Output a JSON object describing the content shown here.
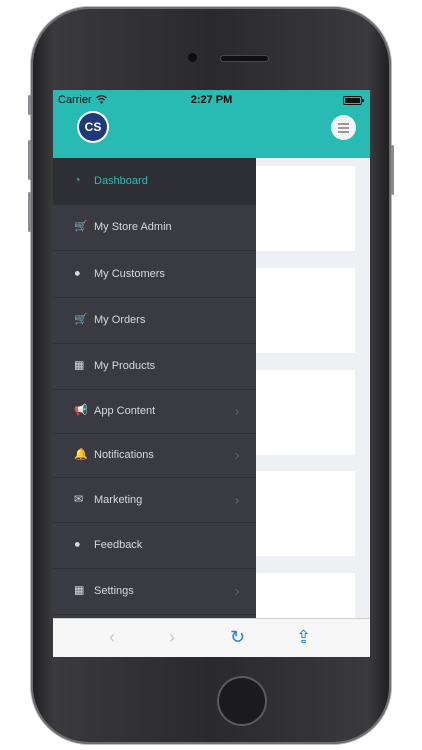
{
  "status_bar": {
    "carrier": "Carrier",
    "time": "2:27 PM"
  },
  "header": {
    "logo_text": "CS",
    "menu_icon": "hamburger-icon"
  },
  "drawer": {
    "items": [
      {
        "label": "Dashboard",
        "icon": "dashboard-icon",
        "glyph": "◔",
        "active": true,
        "submenu": false
      },
      {
        "label": "My Store Admin",
        "icon": "cart-icon",
        "glyph": "🛒",
        "active": false,
        "submenu": false
      },
      {
        "label": "My Customers",
        "icon": "user-icon",
        "glyph": "●",
        "active": false,
        "submenu": false
      },
      {
        "label": "My Orders",
        "icon": "cart-icon",
        "glyph": "🛒",
        "active": false,
        "submenu": false
      },
      {
        "label": "My Products",
        "icon": "grid-icon",
        "glyph": "▦",
        "active": false,
        "submenu": false
      },
      {
        "label": "App Content",
        "icon": "bullhorn-icon",
        "glyph": "📢",
        "active": false,
        "submenu": true
      },
      {
        "label": "Notifications",
        "icon": "bell-icon",
        "glyph": "🔔",
        "active": false,
        "submenu": true
      },
      {
        "label": "Marketing",
        "icon": "envelope-icon",
        "glyph": "✉",
        "active": false,
        "submenu": true
      },
      {
        "label": "Feedback",
        "icon": "user-icon",
        "glyph": "●",
        "active": false,
        "submenu": false
      },
      {
        "label": "Settings",
        "icon": "grid-icon",
        "glyph": "▦",
        "active": false,
        "submenu": true
      }
    ],
    "chevron": "›"
  },
  "toolbar": {
    "back": {
      "icon": "back-arrow-icon",
      "glyph": "‹",
      "enabled": false
    },
    "forward": {
      "icon": "forward-arrow-icon",
      "glyph": "›",
      "enabled": false
    },
    "reload": {
      "icon": "reload-icon",
      "glyph": "↻",
      "enabled": true
    },
    "share": {
      "icon": "share-icon",
      "glyph": "⇪",
      "enabled": true
    }
  },
  "colors": {
    "accent": "#28bbb3",
    "drawer_bg": "#3a3b42",
    "logo_bg": "#1f3a78",
    "link_blue": "#1f7de0"
  }
}
